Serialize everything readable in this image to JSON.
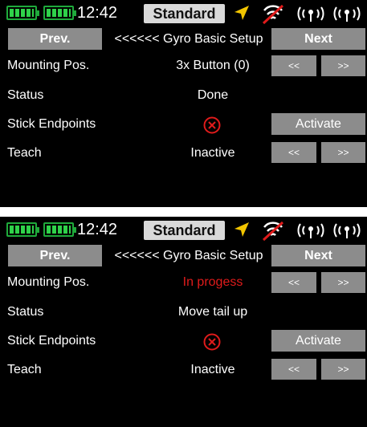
{
  "screens": [
    {
      "status": {
        "time": "12:42",
        "mode": "Standard"
      },
      "nav": {
        "prev": "Prev.",
        "title": "<<<<<< Gyro Basic Setup",
        "next": "Next"
      },
      "rows": {
        "mounting": {
          "label": "Mounting Pos.",
          "value": "3x Button (0)",
          "left": "<<",
          "right": ">>"
        },
        "status": {
          "label": "Status",
          "value": "Done"
        },
        "stick": {
          "label": "Stick Endpoints",
          "icon": "error-x-icon",
          "button": "Activate"
        },
        "teach": {
          "label": "Teach",
          "value": "Inactive",
          "left": "<<",
          "right": ">>"
        }
      }
    },
    {
      "status": {
        "time": "12:42",
        "mode": "Standard"
      },
      "nav": {
        "prev": "Prev.",
        "title": "<<<<<< Gyro Basic Setup",
        "next": "Next"
      },
      "rows": {
        "mounting": {
          "label": "Mounting Pos.",
          "value": "In progess",
          "value_color": "#e01b1b",
          "left": "<<",
          "right": ">>"
        },
        "status": {
          "label": "Status",
          "value": "Move tail up"
        },
        "stick": {
          "label": "Stick Endpoints",
          "icon": "error-x-icon",
          "button": "Activate"
        },
        "teach": {
          "label": "Teach",
          "value": "Inactive",
          "left": "<<",
          "right": ">>"
        }
      }
    }
  ],
  "colors": {
    "accent_green": "#2fd24a",
    "button_gray": "#8c8c8c",
    "arrow_yellow": "#f2c500",
    "error_red": "#e01b1b"
  }
}
